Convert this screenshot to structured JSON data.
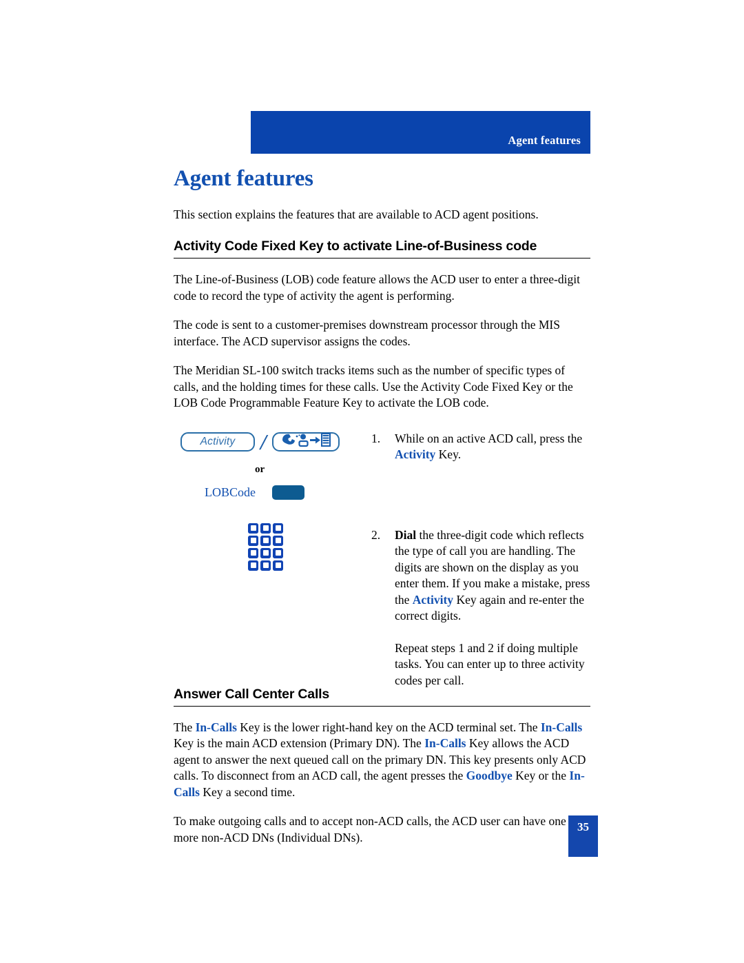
{
  "header": {
    "running_title": "Agent features"
  },
  "chapter": {
    "title": "Agent features",
    "intro": "This section explains the features that are available to ACD agent positions."
  },
  "section_1": {
    "heading": "Activity Code Fixed Key to activate Line-of-Business code",
    "paragraphs": [
      "The Line-of-Business (LOB) code feature allows the ACD user to enter a three-digit code to record the type of activity the agent is performing.",
      "The code is sent to a customer-premises downstream processor through the MIS interface. The ACD supervisor assigns the codes.",
      "The Meridian SL-100 switch tracks items such as the number of specific types of calls, and the holding times for these calls. Use the Activity Code Fixed Key or the LOB Code Programmable Feature Key to activate the LOB code."
    ],
    "graphics": {
      "activity_key_label": "Activity",
      "separator": "/",
      "icon_key_name": "acd-agent-display-icon",
      "or_label": "or",
      "lob_key_label": "LOBCode",
      "lob_key_name": "lobcode-feature-key",
      "keypad_name": "dial-keypad-icon"
    },
    "steps": [
      {
        "number": "1.",
        "parts": [
          {
            "text": "While on an active ACD call, press the ",
            "style": "normal"
          },
          {
            "text": "Activity",
            "style": "blue-bold"
          },
          {
            "text": " Key.",
            "style": "normal"
          }
        ]
      },
      {
        "number": "2.",
        "parts": [
          {
            "text": "Dial",
            "style": "bold"
          },
          {
            "text": " the three-digit code which reflects the type of call you are handling. The digits are shown on the display as you enter them. If you make a mistake, press the ",
            "style": "normal"
          },
          {
            "text": "Activity",
            "style": "blue-bold"
          },
          {
            "text": " Key again and re-enter the correct digits.",
            "style": "normal"
          }
        ],
        "follow_up": "Repeat steps 1 and 2 if doing multiple tasks. You can enter up to three activity codes per call."
      }
    ]
  },
  "section_2": {
    "heading": "Answer Call Center Calls",
    "paragraph_1_parts": [
      {
        "text": "The ",
        "style": "normal"
      },
      {
        "text": "In-Calls",
        "style": "blue-bold"
      },
      {
        "text": " Key is the lower right-hand key on the ACD terminal set. The ",
        "style": "normal"
      },
      {
        "text": "In-Calls",
        "style": "blue-bold"
      },
      {
        "text": " Key is the main ACD extension (Primary DN). The ",
        "style": "normal"
      },
      {
        "text": "In-Calls",
        "style": "blue-bold"
      },
      {
        "text": " Key allows the ACD agent to answer the next queued call on the primary DN. This key presents only ACD calls. To disconnect from an ACD call, the agent presses the ",
        "style": "normal"
      },
      {
        "text": "Goodbye",
        "style": "blue-bold"
      },
      {
        "text": " Key or the ",
        "style": "normal"
      },
      {
        "text": "In-Calls",
        "style": "blue-bold"
      },
      {
        "text": " Key a second time.",
        "style": "normal"
      }
    ],
    "paragraph_2": "To make outgoing calls and to accept non-ACD calls, the ACD user can have one or more non-ACD DNs (Individual DNs)."
  },
  "footer": {
    "page_number": "35"
  },
  "colors": {
    "banner_blue": "#0a44ad",
    "heading_blue": "#1250b0",
    "key_outline_blue": "#2a6fa8",
    "key_fill_blue": "#0d5b91",
    "keypad_blue": "#1144b4",
    "page_box_blue": "#1447ad"
  }
}
